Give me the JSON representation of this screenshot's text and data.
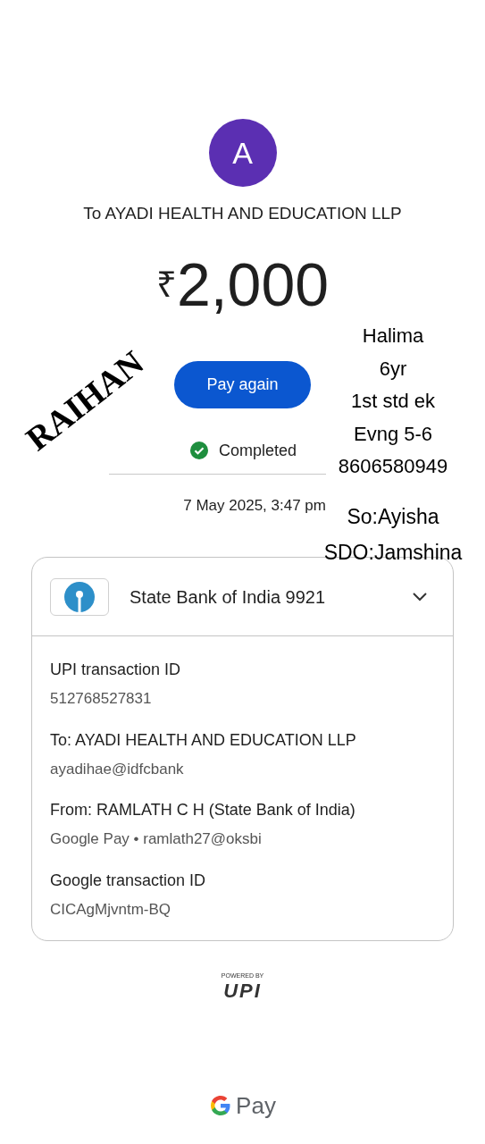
{
  "avatar": {
    "initial": "A"
  },
  "recipient": "To AYADI HEALTH AND EDUCATION LLP",
  "amount": {
    "currency": "₹",
    "value": "2,000"
  },
  "pay_again_button": "Pay again",
  "status": {
    "label": "Completed",
    "completed": true
  },
  "date": "7 May 2025, 3:47 pm",
  "account": {
    "name": "State Bank of India 9921",
    "expanded": false
  },
  "details": [
    {
      "label": "UPI transaction ID",
      "value": "512768527831"
    },
    {
      "label": "To: AYADI HEALTH AND EDUCATION LLP",
      "value": "ayadihae@idfcbank"
    },
    {
      "label": "From: RAMLATH  C H (State Bank of India)",
      "value": "Google Pay • ramlath27@oksbi"
    },
    {
      "label": "Google transaction ID",
      "value": "CICAgMjvntm-BQ"
    }
  ],
  "upi_badge": {
    "powered_by": "POWERED BY",
    "mark": "UPI"
  },
  "footer": {
    "brand": "Pay"
  },
  "annotations": {
    "stamp": "RAIHAN",
    "note_lines": [
      "Halima",
      "6yr",
      "1st std ek",
      "Evng 5-6",
      "8606580949"
    ],
    "note_lines_lower": [
      "So:Ayisha",
      "SDO:Jamshina"
    ]
  }
}
